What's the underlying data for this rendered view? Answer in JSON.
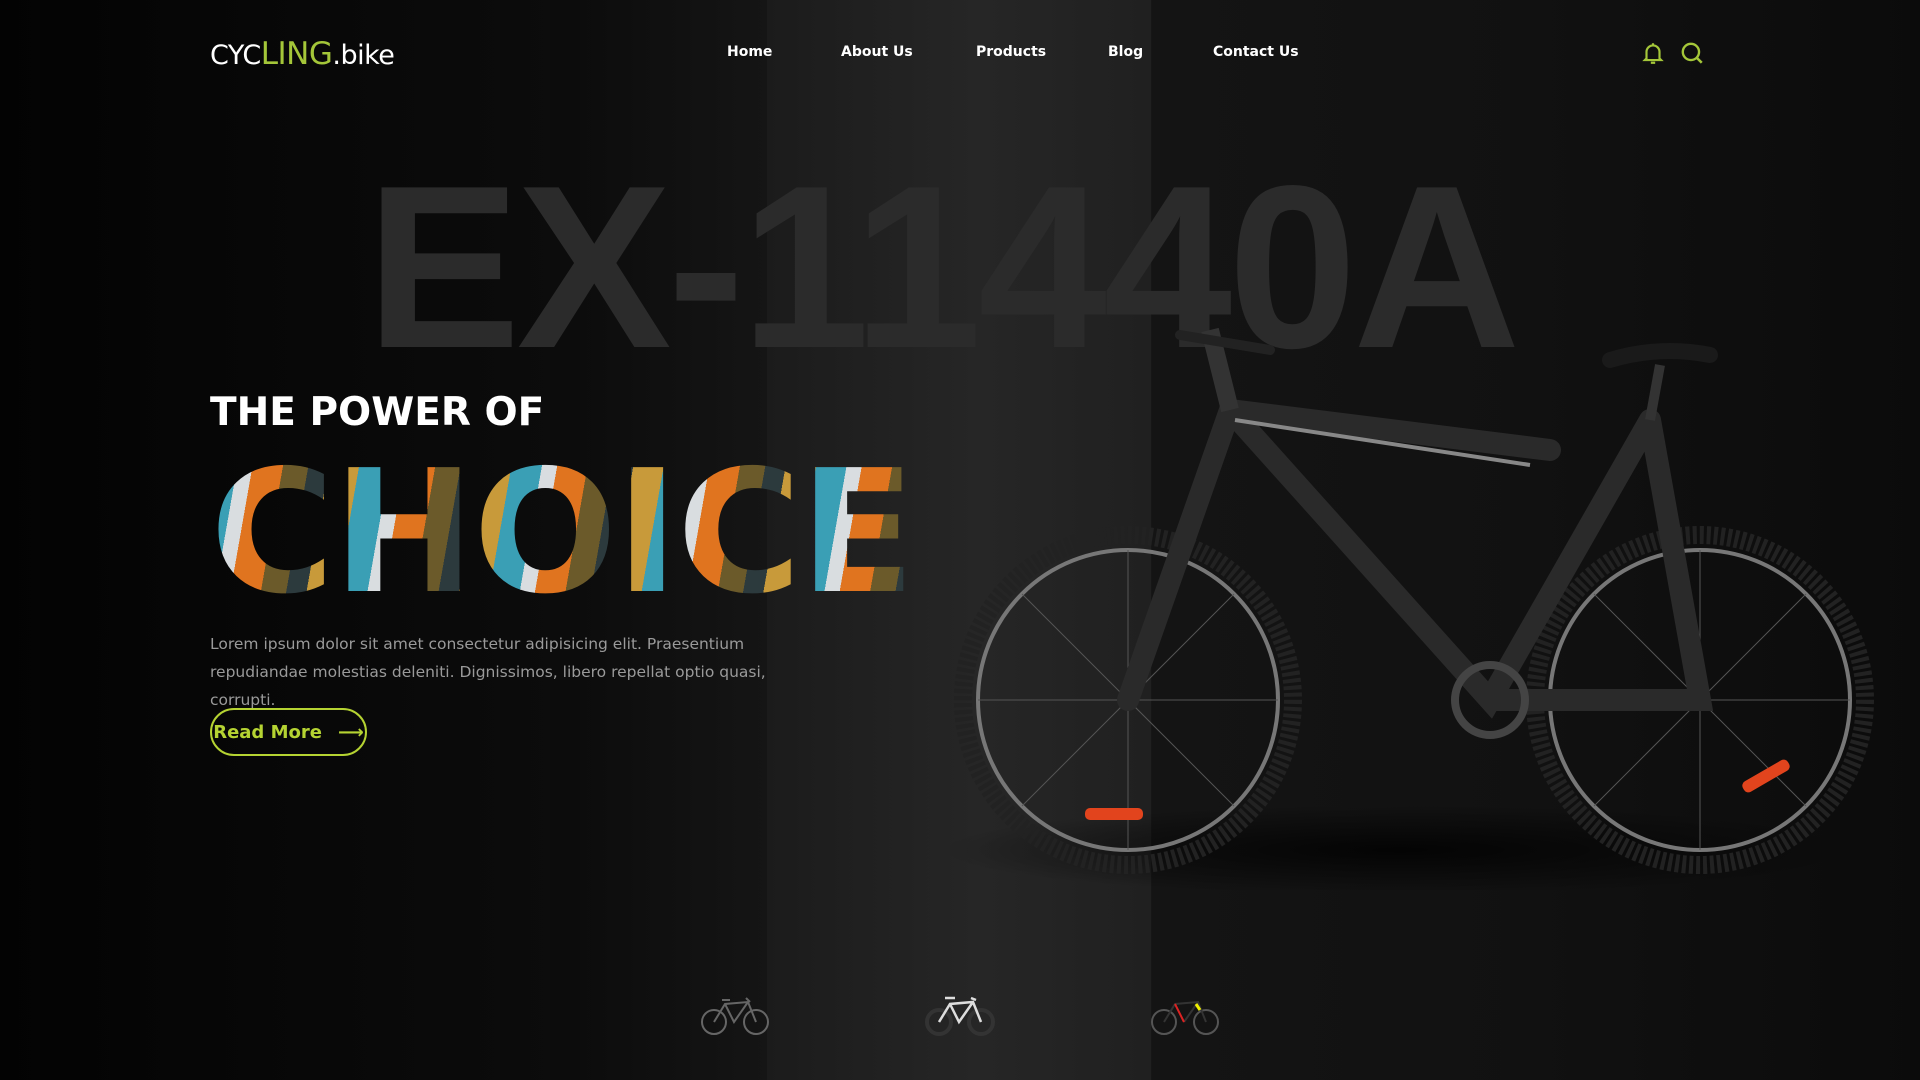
{
  "brand": {
    "part1": "CYC",
    "part2": "LING",
    "part3": ".bike",
    "accent": "#a4c639"
  },
  "nav": {
    "items": [
      {
        "label": "Home"
      },
      {
        "label": "About Us"
      },
      {
        "label": "Products"
      },
      {
        "label": "Blog"
      },
      {
        "label": "Contact Us"
      }
    ]
  },
  "header_icons": [
    "bell-icon",
    "search-icon"
  ],
  "hero": {
    "model": "EX-11440A",
    "kicker": "THE POWER OF",
    "headline": "CHOICE",
    "description": "Lorem ipsum dolor sit amet consectetur adipisicing elit. Praesentium repudiandae molestias deleniti. Dignissimos, libero repellat optio quasi, corrupti.",
    "cta_label": "Read More",
    "cta_icon": "arrow-right-icon"
  },
  "thumbnails": [
    {
      "name": "grey-gravel-bike"
    },
    {
      "name": "white-road-bike"
    },
    {
      "name": "black-red-yellow-road-bike"
    }
  ]
}
